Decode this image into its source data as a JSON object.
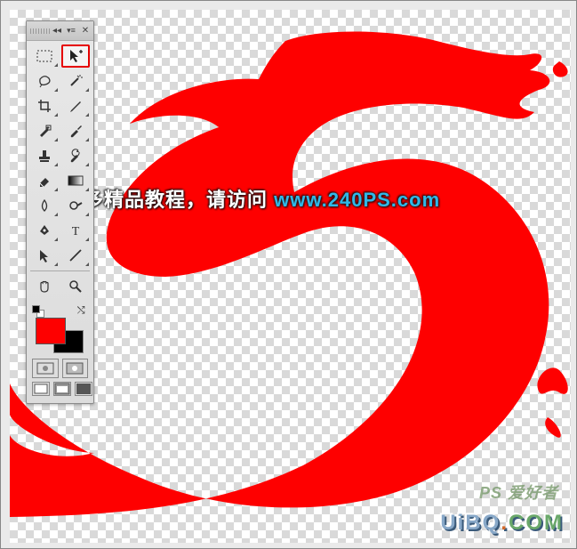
{
  "tools": {
    "marquee": "marquee-tool",
    "move": "move-tool",
    "lasso": "lasso-tool",
    "wand": "magic-wand-tool",
    "crop": "crop-tool",
    "eyedropper": "eyedropper-tool",
    "healing": "healing-brush-tool",
    "brush": "brush-tool",
    "stamp": "clone-stamp-tool",
    "history": "history-brush-tool",
    "eraser": "eraser-tool",
    "gradient": "gradient-tool",
    "blur": "blur-tool",
    "dodge": "dodge-tool",
    "pen": "pen-tool",
    "type": "type-tool",
    "path": "path-selection-tool",
    "line": "line-tool",
    "hand": "hand-tool",
    "zoom": "zoom-tool"
  },
  "colors": {
    "foreground": "#fe0000",
    "background": "#000000",
    "brush_art": "#fe0000"
  },
  "overlay": {
    "text_prefix": "更多精品教程，请访问 ",
    "url": "www.240PS.com"
  },
  "watermark": {
    "ps": "PS 爱好者",
    "uibq": "UiBQ",
    "dot": ".",
    "com": "COM"
  }
}
